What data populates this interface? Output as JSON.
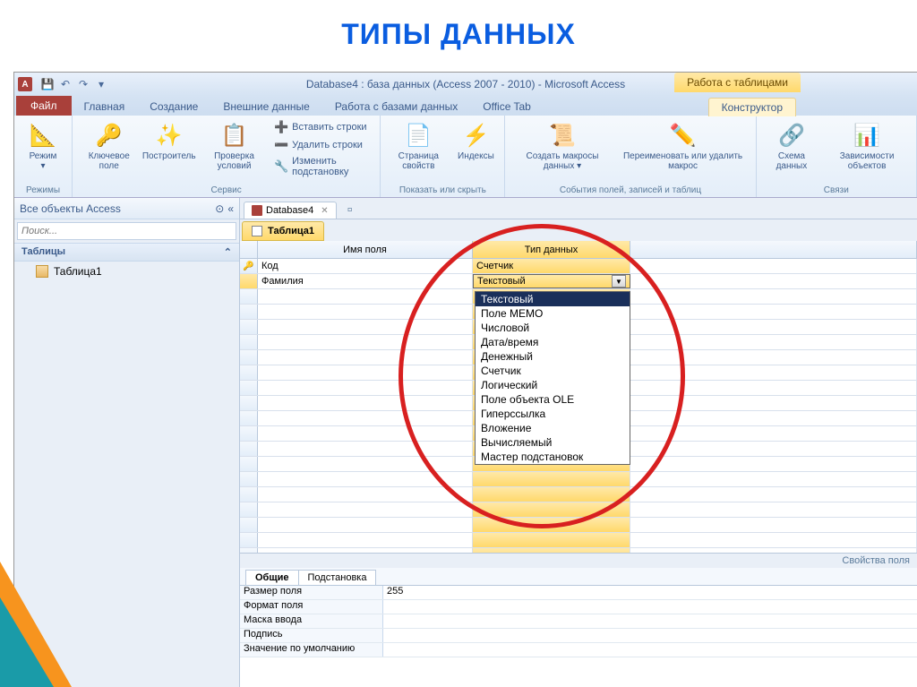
{
  "slide_title": "ТИПЫ ДАННЫХ",
  "titlebar": {
    "app_icon": "A",
    "title": "Database4 : база данных (Access 2007 - 2010)  -  Microsoft Access",
    "context_title": "Работа с таблицами"
  },
  "tabs": {
    "file": "Файл",
    "home": "Главная",
    "create": "Создание",
    "external": "Внешние данные",
    "dbtools": "Работа с базами данных",
    "office": "Office Tab",
    "design": "Конструктор"
  },
  "ribbon": {
    "views": {
      "btn": "Режим",
      "group": "Режимы"
    },
    "tools": {
      "key": "Ключевое поле",
      "builder": "Построитель",
      "validate": "Проверка условий",
      "insert_rows": "Вставить строки",
      "delete_rows": "Удалить строки",
      "modify_lookup": "Изменить подстановку",
      "group": "Сервис"
    },
    "show": {
      "sheet": "Страница свойств",
      "indexes": "Индексы",
      "group": "Показать или скрыть"
    },
    "events": {
      "create_macros": "Создать макросы данных ▾",
      "rename_macro": "Переименовать или удалить макрос",
      "group": "События полей, записей и таблиц"
    },
    "rel": {
      "relations": "Схема данных",
      "deps": "Зависимости объектов",
      "group": "Связи"
    }
  },
  "nav": {
    "header": "Все объекты Access",
    "search_placeholder": "Поиск...",
    "group": "Таблицы",
    "item": "Таблица1"
  },
  "doc_tab": "Database4",
  "obj_tab": "Таблица1",
  "grid": {
    "col_name": "Имя поля",
    "col_type": "Тип данных",
    "row1_name": "Код",
    "row1_type": "Счетчик",
    "row2_name": "Фамилия",
    "row2_type": "Текстовый"
  },
  "dropdown": {
    "items": [
      "Текстовый",
      "Поле МЕМО",
      "Числовой",
      "Дата/время",
      "Денежный",
      "Счетчик",
      "Логический",
      "Поле объекта OLE",
      "Гиперссылка",
      "Вложение",
      "Вычисляемый",
      "Мастер подстановок"
    ]
  },
  "props": {
    "title": "Свойства поля",
    "tab_general": "Общие",
    "tab_lookup": "Подстановка",
    "rows": [
      {
        "name": "Размер поля",
        "val": "255"
      },
      {
        "name": "Формат поля",
        "val": ""
      },
      {
        "name": "Маска ввода",
        "val": ""
      },
      {
        "name": "Подпись",
        "val": ""
      },
      {
        "name": "Значение по умолчанию",
        "val": ""
      }
    ]
  }
}
